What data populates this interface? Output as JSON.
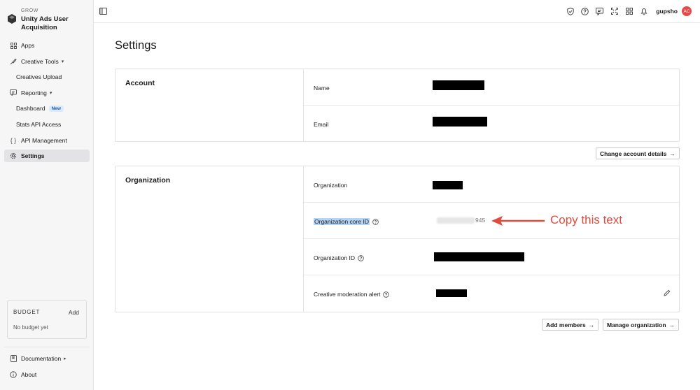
{
  "brand": {
    "small_label": "GROW",
    "name": "Unity Ads User Acquisition"
  },
  "nav": {
    "apps": "Apps",
    "creative_tools": "Creative Tools",
    "creatives_upload": "Creatives Upload",
    "reporting": "Reporting",
    "dashboard": "Dashboard",
    "dashboard_badge": "New",
    "stats_api": "Stats API Access",
    "api_management": "API Management",
    "settings": "Settings"
  },
  "budget": {
    "title": "BUDGET",
    "add": "Add",
    "empty": "No budget yet"
  },
  "bottom_nav": {
    "documentation": "Documentation",
    "about": "About"
  },
  "topbar": {
    "username": "gupsho",
    "avatar_initials": "AC"
  },
  "page": {
    "title": "Settings"
  },
  "account": {
    "title": "Account",
    "rows": [
      {
        "label": "Name"
      },
      {
        "label": "Email"
      }
    ],
    "button": "Change account details"
  },
  "organization": {
    "title": "Organization",
    "rows": [
      {
        "label": "Organization"
      },
      {
        "label": "Organization core ID",
        "value_tail": "945"
      },
      {
        "label": "Organization ID"
      },
      {
        "label": "Creative moderation alert"
      }
    ],
    "add_members": "Add members",
    "manage": "Manage organization"
  },
  "annotation": {
    "text": "Copy this text",
    "color": "#e24a3d"
  },
  "colors": {
    "avatar": "#e54848",
    "badge_bg": "#d9eaff",
    "selection": "#b3d4f5"
  }
}
